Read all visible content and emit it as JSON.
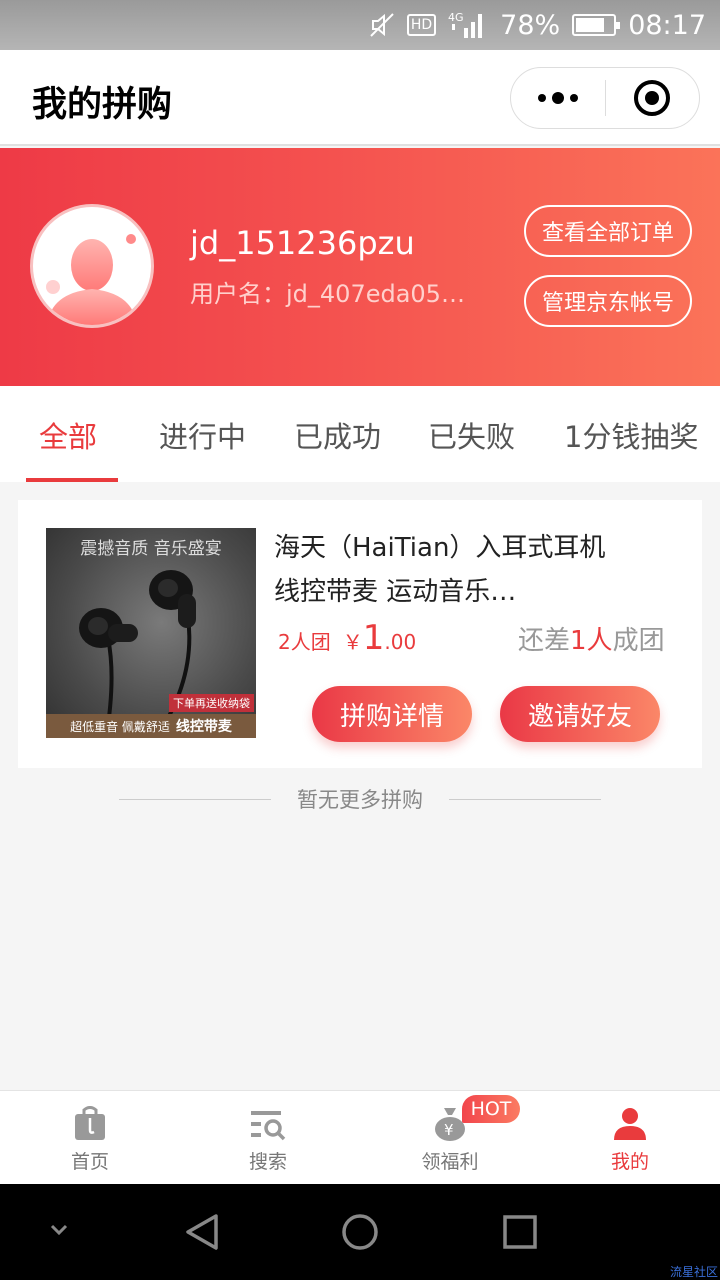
{
  "status_bar": {
    "battery": "78%",
    "battery_level": 0.78,
    "time": "08:17",
    "hd": "HD",
    "network": "4G"
  },
  "navbar": {
    "title": "我的拼购"
  },
  "profile": {
    "nickname": "jd_151236pzu",
    "username": "用户名：jd_407eda05…",
    "btn_orders": "查看全部订单",
    "btn_account": "管理京东帐号"
  },
  "tabs": [
    {
      "label": "全部"
    },
    {
      "label": "进行中"
    },
    {
      "label": "已成功"
    },
    {
      "label": "已失败"
    },
    {
      "label": "1分钱抽奖"
    }
  ],
  "order": {
    "thumb_top": "震撼音质  音乐盛宴",
    "thumb_tag": "下单再送收纳袋",
    "thumb_bottom_1": "超低重音  佩戴舒适",
    "thumb_bottom_2": "线控带麦",
    "title": "海天（HaiTian）入耳式耳机线控带麦 运动音乐…",
    "group_size": "2人团",
    "price_symbol": "￥",
    "price_int": "1",
    "price_dec": ".00",
    "short_pre": "还差",
    "short_num": "1人",
    "short_post": "成团",
    "btn_detail": "拼购详情",
    "btn_invite": "邀请好友"
  },
  "no_more": "暂无更多拼购",
  "tabbar": {
    "home": "首页",
    "search": "搜索",
    "welfare": "领福利",
    "mine": "我的",
    "hot": "HOT"
  },
  "watermark": "流星社区",
  "colors": {
    "accent": "#e93b3d",
    "banner_start": "#ee3a46",
    "banner_end": "#fb7359"
  }
}
